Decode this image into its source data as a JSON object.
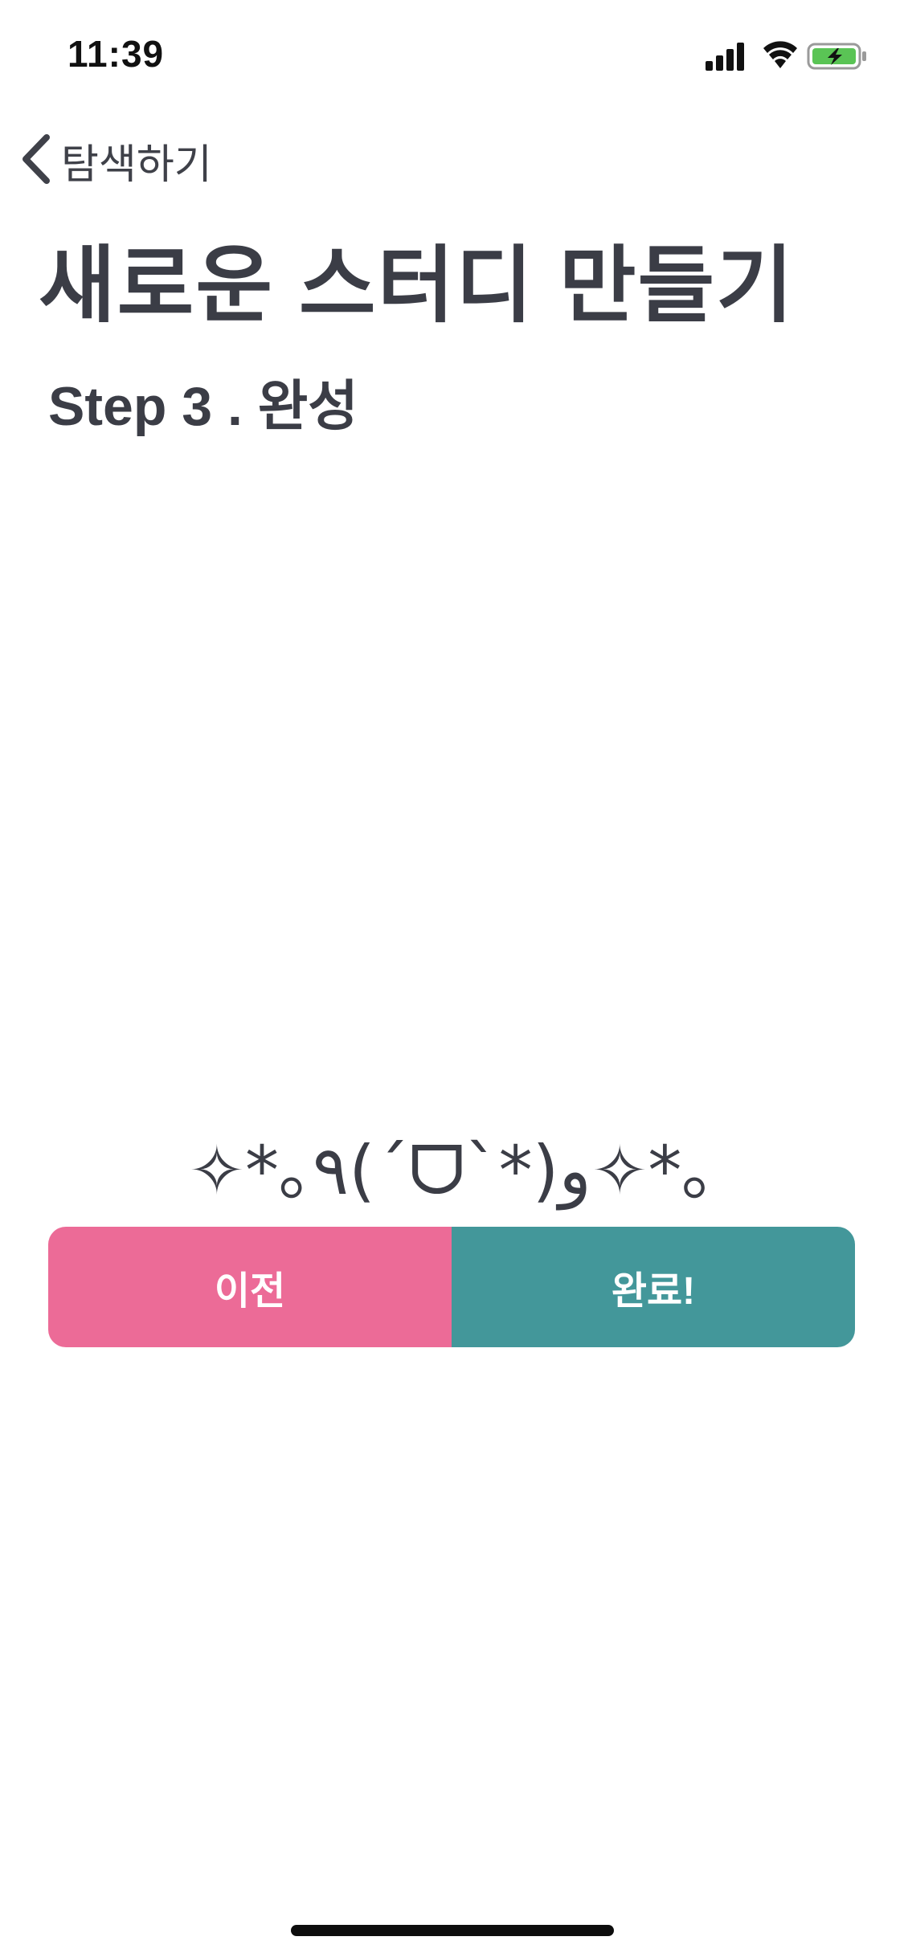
{
  "status_bar": {
    "time": "11:39"
  },
  "nav": {
    "back_label": "탐색하기"
  },
  "header": {
    "title": "새로운 스터디 만들기",
    "step_label": "Step 3 . 완성"
  },
  "main": {
    "kaomoji": "✧*｡٩(ˊᗜˋ*)و✧*｡"
  },
  "buttons": {
    "prev_label": "이전",
    "done_label": "완료!"
  },
  "colors": {
    "prev_button": "#ec6b97",
    "done_button": "#43979a",
    "battery_fill": "#5ac455",
    "text": "#3b3d46"
  },
  "icons": {
    "signal": "cellular-signal-icon",
    "wifi": "wifi-icon",
    "battery": "battery-charging-icon",
    "back": "chevron-left-icon"
  }
}
